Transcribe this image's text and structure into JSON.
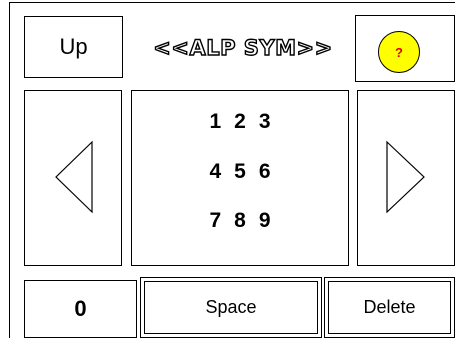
{
  "top_bar": {
    "up_label": "Up",
    "title": "<<ALP  SYM>>",
    "help_label": "?"
  },
  "keypad": {
    "rows": [
      [
        "1",
        "2",
        "3"
      ],
      [
        "4",
        "5",
        "6"
      ],
      [
        "7",
        "8",
        "9"
      ]
    ]
  },
  "navigation": {
    "left_icon": "triangle-left-icon",
    "right_icon": "triangle-right-icon"
  },
  "bottom_bar": {
    "zero_label": "0",
    "space_label": "Space",
    "delete_label": "Delete"
  },
  "colors": {
    "help_fill": "#ffff00",
    "help_text": "#e00000"
  }
}
